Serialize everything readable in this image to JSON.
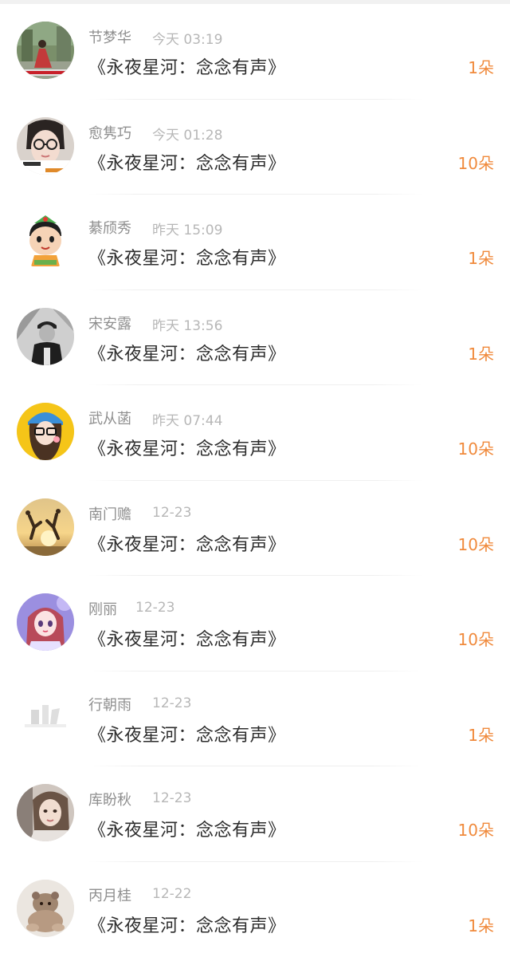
{
  "gift_list": [
    {
      "name": "节梦华",
      "time": "今天 03:19",
      "title": "《永夜星河：念念有声》",
      "amount": "1朵",
      "avatar": "avatar-woman-red-dress"
    },
    {
      "name": "愈隽巧",
      "time": "今天 01:28",
      "title": "《永夜星河：念念有声》",
      "amount": "10朵",
      "avatar": "avatar-girl-glasses"
    },
    {
      "name": "綦颀秀",
      "time": "昨天 15:09",
      "title": "《永夜星河：念念有声》",
      "amount": "1朵",
      "avatar": "avatar-cartoon-kid"
    },
    {
      "name": "宋安露",
      "time": "昨天 13:56",
      "title": "《永夜星河：念念有声》",
      "amount": "1朵",
      "avatar": "avatar-man-cap-bw"
    },
    {
      "name": "武从菡",
      "time": "昨天 07:44",
      "title": "《永夜星河：念念有声》",
      "amount": "10朵",
      "avatar": "avatar-cartoon-girl-yellow"
    },
    {
      "name": "南门赡",
      "time": "12-23",
      "title": "《永夜星河：念念有声》",
      "amount": "10朵",
      "avatar": "avatar-sunset-jump"
    },
    {
      "name": "刚丽",
      "time": "12-23",
      "title": "《永夜星河：念念有声》",
      "amount": "10朵",
      "avatar": "avatar-anime-girl"
    },
    {
      "name": "行朝雨",
      "time": "12-23",
      "title": "《永夜星河：念念有声》",
      "amount": "1朵",
      "avatar": "avatar-faded-white"
    },
    {
      "name": "库盼秋",
      "time": "12-23",
      "title": "《永夜星河：念念有声》",
      "amount": "10朵",
      "avatar": "avatar-woman-portrait"
    },
    {
      "name": "丙月桂",
      "time": "12-22",
      "title": "《永夜星河：念念有声》",
      "amount": "1朵",
      "avatar": "avatar-plush-toy"
    }
  ],
  "colors": {
    "accent": "#f08a3c",
    "name_text": "#8f8f8f",
    "time_text": "#b7b7b7",
    "title_text": "#2e2e2e"
  }
}
